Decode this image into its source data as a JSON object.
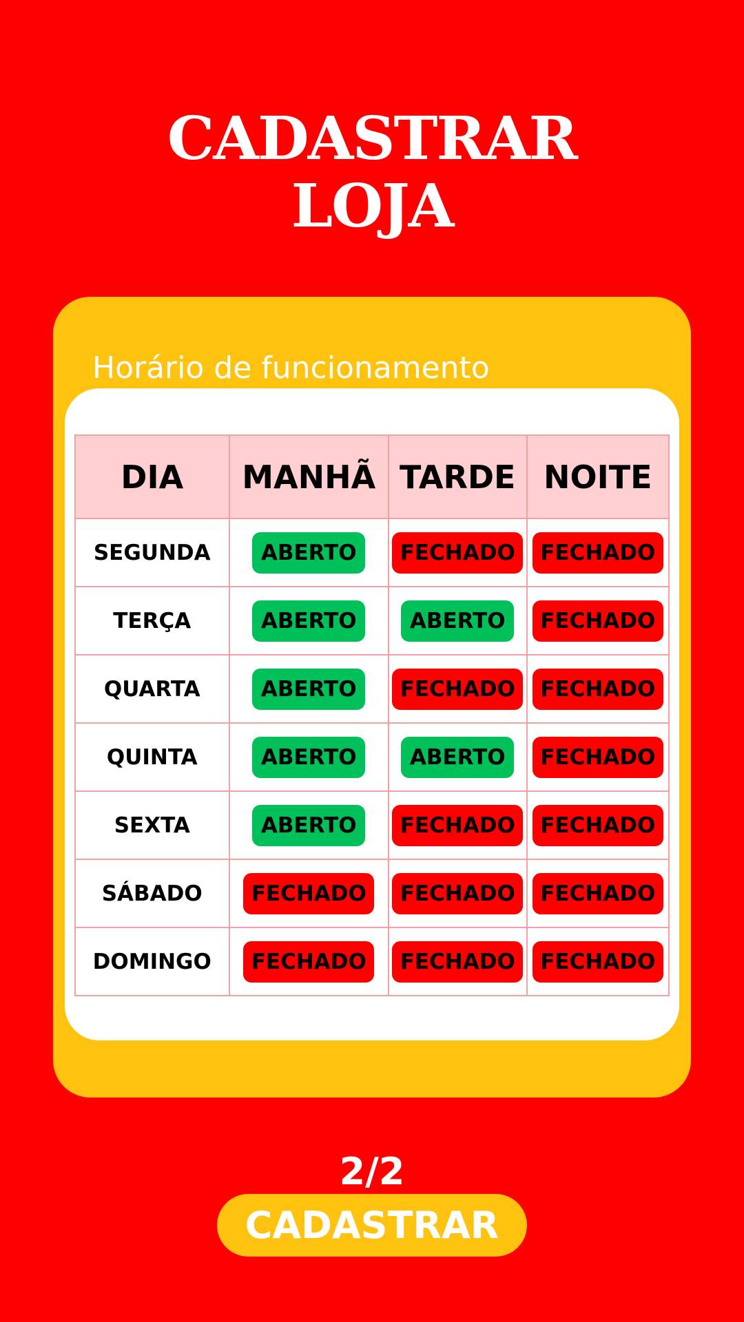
{
  "header": {
    "title_line1": "CADASTRAR",
    "title_line2": "LOJA"
  },
  "schedule": {
    "label": "Horário de funcionamento",
    "columns": [
      "DIA",
      "MANHÃ",
      "TARDE",
      "NOITE"
    ],
    "rows": [
      {
        "day": "SEGUNDA",
        "manha": "ABERTO",
        "tarde": "FECHADO",
        "noite": "FECHADO"
      },
      {
        "day": "TERÇA",
        "manha": "ABERTO",
        "tarde": "ABERTO",
        "noite": "FECHADO"
      },
      {
        "day": "QUARTA",
        "manha": "ABERTO",
        "tarde": "FECHADO",
        "noite": "FECHADO"
      },
      {
        "day": "QUINTA",
        "manha": "ABERTO",
        "tarde": "ABERTO",
        "noite": "FECHADO"
      },
      {
        "day": "SEXTA",
        "manha": "ABERTO",
        "tarde": "FECHADO",
        "noite": "FECHADO"
      },
      {
        "day": "SÁBADO",
        "manha": "FECHADO",
        "tarde": "FECHADO",
        "noite": "FECHADO"
      },
      {
        "day": "DOMINGO",
        "manha": "FECHADO",
        "tarde": "FECHADO",
        "noite": "FECHADO"
      }
    ]
  },
  "footer": {
    "page_counter": "2/2",
    "submit_label": "CADASTRAR"
  },
  "colors": {
    "background": "#ff0000",
    "card": "#fec20f",
    "open_badge": "#00c05a",
    "closed_badge": "#ff0000",
    "table_header": "#ffcfd1",
    "table_border": "#f3a0a0"
  }
}
